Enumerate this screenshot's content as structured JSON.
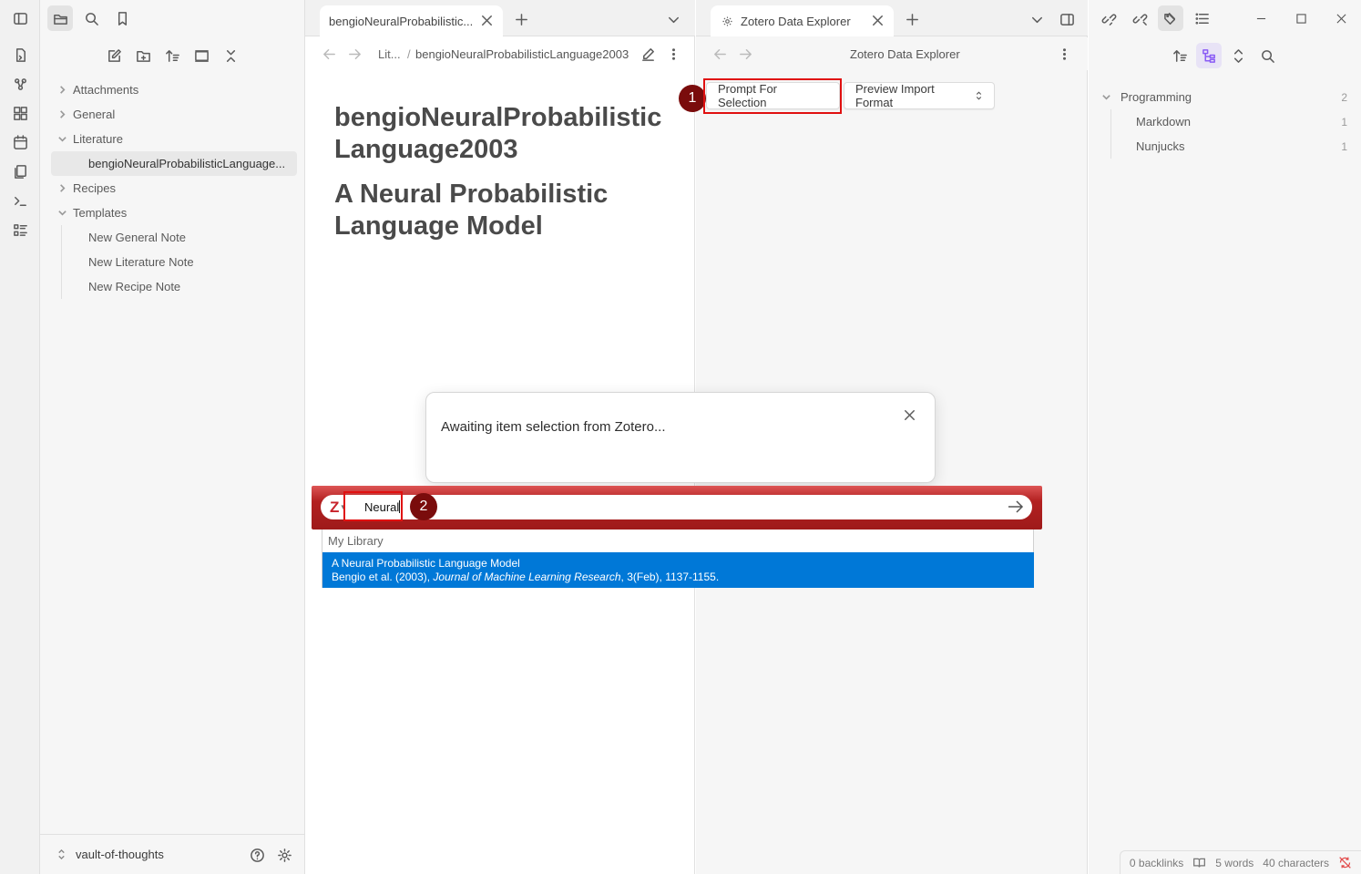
{
  "explorer": {
    "tree": [
      {
        "label": "Attachments",
        "type": "folder",
        "open": false
      },
      {
        "label": "General",
        "type": "folder",
        "open": false
      },
      {
        "label": "Literature",
        "type": "folder",
        "open": true
      },
      {
        "label": "bengioNeuralProbabilisticLanguage...",
        "type": "file",
        "selected": true
      },
      {
        "label": "Recipes",
        "type": "folder",
        "open": false
      },
      {
        "label": "Templates",
        "type": "folder",
        "open": true
      },
      {
        "label": "New General Note",
        "type": "file"
      },
      {
        "label": "New Literature Note",
        "type": "file"
      },
      {
        "label": "New Recipe Note",
        "type": "file"
      }
    ],
    "vault_name": "vault-of-thoughts"
  },
  "editor": {
    "tab_title": "bengioNeuralProbabilistic...",
    "breadcrumb_folder": "Lit...",
    "breadcrumb_sep": "/",
    "breadcrumb_file": "bengioNeuralProbabilisticLanguage2003",
    "heading1": "bengioNeuralProbabilistic Language2003",
    "heading2": "A Neural Probabilistic Language Model"
  },
  "plugin": {
    "tab_title": "Zotero Data Explorer",
    "view_title": "Zotero Data Explorer",
    "prompt_button": "Prompt For Selection",
    "format_select": "Preview Import Format",
    "step1": "1",
    "step2": "2"
  },
  "modal": {
    "message": "Awaiting item selection from Zotero..."
  },
  "zotero": {
    "logo": "Z",
    "query": "Neural",
    "library_header": "My Library",
    "result_title": "A Neural Probabilistic Language Model",
    "result_citation_prefix": "Bengio et al. (2003), ",
    "result_journal": "Journal of Machine Learning Research",
    "result_citation_suffix": ", 3(Feb), 1137-1155.",
    "brand_color": "#a51d1d",
    "selection_color": "#0078d7"
  },
  "tags": [
    {
      "label": "Programming",
      "count": "2",
      "child": false
    },
    {
      "label": "Markdown",
      "count": "1",
      "child": true
    },
    {
      "label": "Nunjucks",
      "count": "1",
      "child": true
    }
  ],
  "status": {
    "backlinks": "0 backlinks",
    "words": "5 words",
    "chars": "40 characters"
  },
  "highlight_color": "#e01010"
}
